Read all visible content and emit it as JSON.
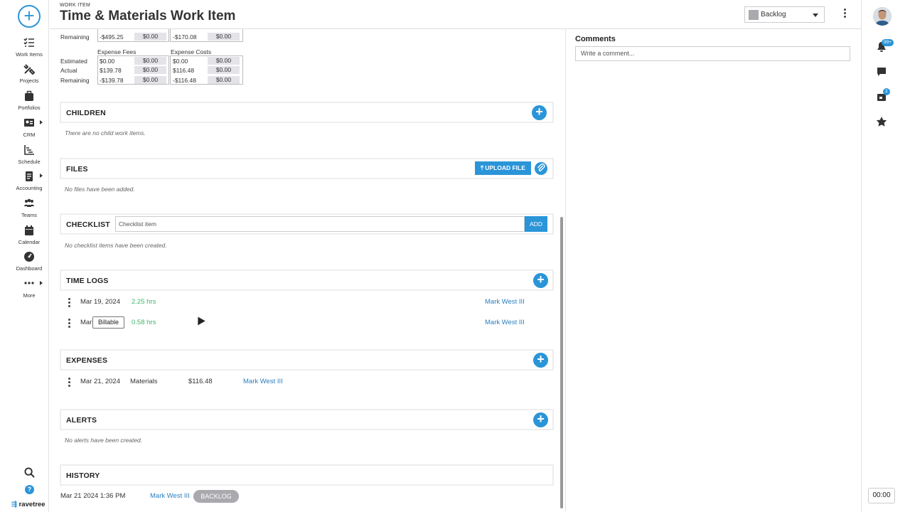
{
  "header": {
    "eyebrow": "WORK ITEM",
    "title": "Time & Materials Work Item",
    "status": "Backlog",
    "status_color": "#a9a9ae"
  },
  "nav": {
    "new_button": "+",
    "items": [
      {
        "label": "Work Items",
        "icon": "list-check-icon"
      },
      {
        "label": "Projects",
        "icon": "tools-icon"
      },
      {
        "label": "Portfolios",
        "icon": "briefcase-icon"
      },
      {
        "label": "CRM",
        "icon": "contact-card-icon"
      },
      {
        "label": "Schedule",
        "icon": "chart-icon"
      },
      {
        "label": "Accounting",
        "icon": "document-icon"
      },
      {
        "label": "Teams",
        "icon": "people-icon"
      },
      {
        "label": "Calendar",
        "icon": "calendar-icon"
      },
      {
        "label": "Dashboard",
        "icon": "gauge-icon"
      },
      {
        "label": "More",
        "icon": "ellipsis-icon"
      }
    ],
    "brand": "ravetree"
  },
  "financials": {
    "remaining_top": {
      "label": "Remaining",
      "v1": "-$495.25",
      "v2": "$0.00",
      "v3": "-$170.08",
      "v4": "$0.00"
    },
    "fees_header": "Expense Fees",
    "costs_header": "Expense Costs",
    "rows": [
      {
        "label": "Estimated",
        "f1": "$0.00",
        "f2": "$0.00",
        "c1": "$0.00",
        "c2": "$0.00"
      },
      {
        "label": "Actual",
        "f1": "$139.78",
        "f2": "$0.00",
        "c1": "$116.48",
        "c2": "$0.00"
      },
      {
        "label": "Remaining",
        "f1": "-$139.78",
        "f2": "$0.00",
        "c1": "-$116.48",
        "c2": "$0.00"
      }
    ]
  },
  "children": {
    "title": "CHILDREN",
    "empty": "There are no child work items."
  },
  "files": {
    "title": "FILES",
    "upload_label": "UPLOAD FILE",
    "empty": "No files have been added."
  },
  "checklist": {
    "title": "CHECKLIST",
    "placeholder": "Checklist item",
    "add_label": "ADD",
    "empty": "No checklist items have been created."
  },
  "timelogs": {
    "title": "TIME LOGS",
    "rows": [
      {
        "date": "Mar 19, 2024",
        "hours": "2.25 hrs",
        "user": "Mark West III"
      },
      {
        "date": "Mar",
        "hours": "0.58 hrs",
        "user": "Mark West III"
      }
    ],
    "tooltip": "Billable"
  },
  "expenses": {
    "title": "EXPENSES",
    "rows": [
      {
        "date": "Mar 21, 2024",
        "category": "Materials",
        "amount": "$116.48",
        "user": "Mark West III"
      }
    ]
  },
  "alerts": {
    "title": "ALERTS",
    "empty": "No alerts have been created."
  },
  "history": {
    "title": "HISTORY",
    "rows": [
      {
        "datetime": "Mar 21 2024 1:36 PM",
        "user": "Mark West III",
        "status": "BACKLOG"
      }
    ]
  },
  "comments": {
    "title": "Comments",
    "placeholder": "Write a comment..."
  },
  "rail": {
    "notifications_badge": "99+",
    "inbox_badge": "2",
    "timer": "00:00"
  },
  "colors": {
    "accent": "#2a95d8",
    "hours_green": "#3fb56a",
    "link_blue": "#2a7fc1"
  }
}
